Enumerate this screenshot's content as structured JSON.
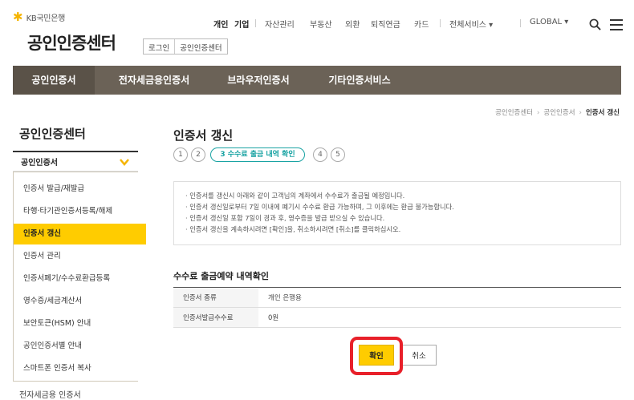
{
  "brand": {
    "logo_text": "KB국민은행",
    "site_title": "공인인증센터"
  },
  "login_box": {
    "login": "로그인",
    "cert_center": "공인인증센터"
  },
  "topnav": {
    "personal": "개인",
    "business": "기업",
    "asset": "자산관리",
    "realestate": "부동산",
    "fx": "외환",
    "pension": "퇴직연금",
    "card": "카드",
    "all_services": "전체서비스 ▾",
    "global": "GLOBAL ▾"
  },
  "mainnav": [
    "공인인증서",
    "전자세금용인증서",
    "브라우저인증서",
    "기타인증서비스"
  ],
  "breadcrumb": {
    "level1": "공인인증센터",
    "level2": "공인인증서",
    "current": "인증서 갱신"
  },
  "sidebar": {
    "title": "공인인증센터",
    "section": "공인인증서",
    "items": [
      "인증서 발급/재발급",
      "타행·타기관인증서등록/해제",
      "인증서 갱신",
      "인증서 관리",
      "인증서폐기/수수료환급등록",
      "영수증/세금계산서",
      "보안토큰(HSM) 안내",
      "공인인증서별 안내",
      "스마트폰 인증서 복사"
    ],
    "active_index": 2,
    "bottom_item": "전자세금용 인증서"
  },
  "content": {
    "title": "인증서 갱신",
    "steps": [
      "1",
      "2",
      "3 수수료 출금 내역 확인",
      "4",
      "5"
    ],
    "notices": [
      "· 인증서를 갱신시 아래와 같이 고객님의 계좌에서 수수료가 출금될 예정입니다.",
      "· 인증서 갱신일로부터 7일 이내에 폐기시 수수료 환급 가능하며, 그 이후에는 환급 불가능합니다.",
      "· 인증서 갱신일 포함 7일이 경과 후, 영수증을 발급 받으실 수 있습니다.",
      "· 인증서 갱신을 계속하시려면 [확인]을, 취소하시려면 [취소]를 클릭하십시오."
    ],
    "section_title": "수수료 출금예약 내역확인",
    "table": [
      {
        "label": "인증서 종류",
        "value": "개인 은행용"
      },
      {
        "label": "인증서발급수수료",
        "value": "0원"
      }
    ],
    "confirm": "확인",
    "cancel": "취소"
  },
  "colors": {
    "accent_yellow": "#ffcc00",
    "nav_brown": "#6b6257",
    "step_teal": "#19a3a3",
    "highlight_red": "#e8202a"
  }
}
